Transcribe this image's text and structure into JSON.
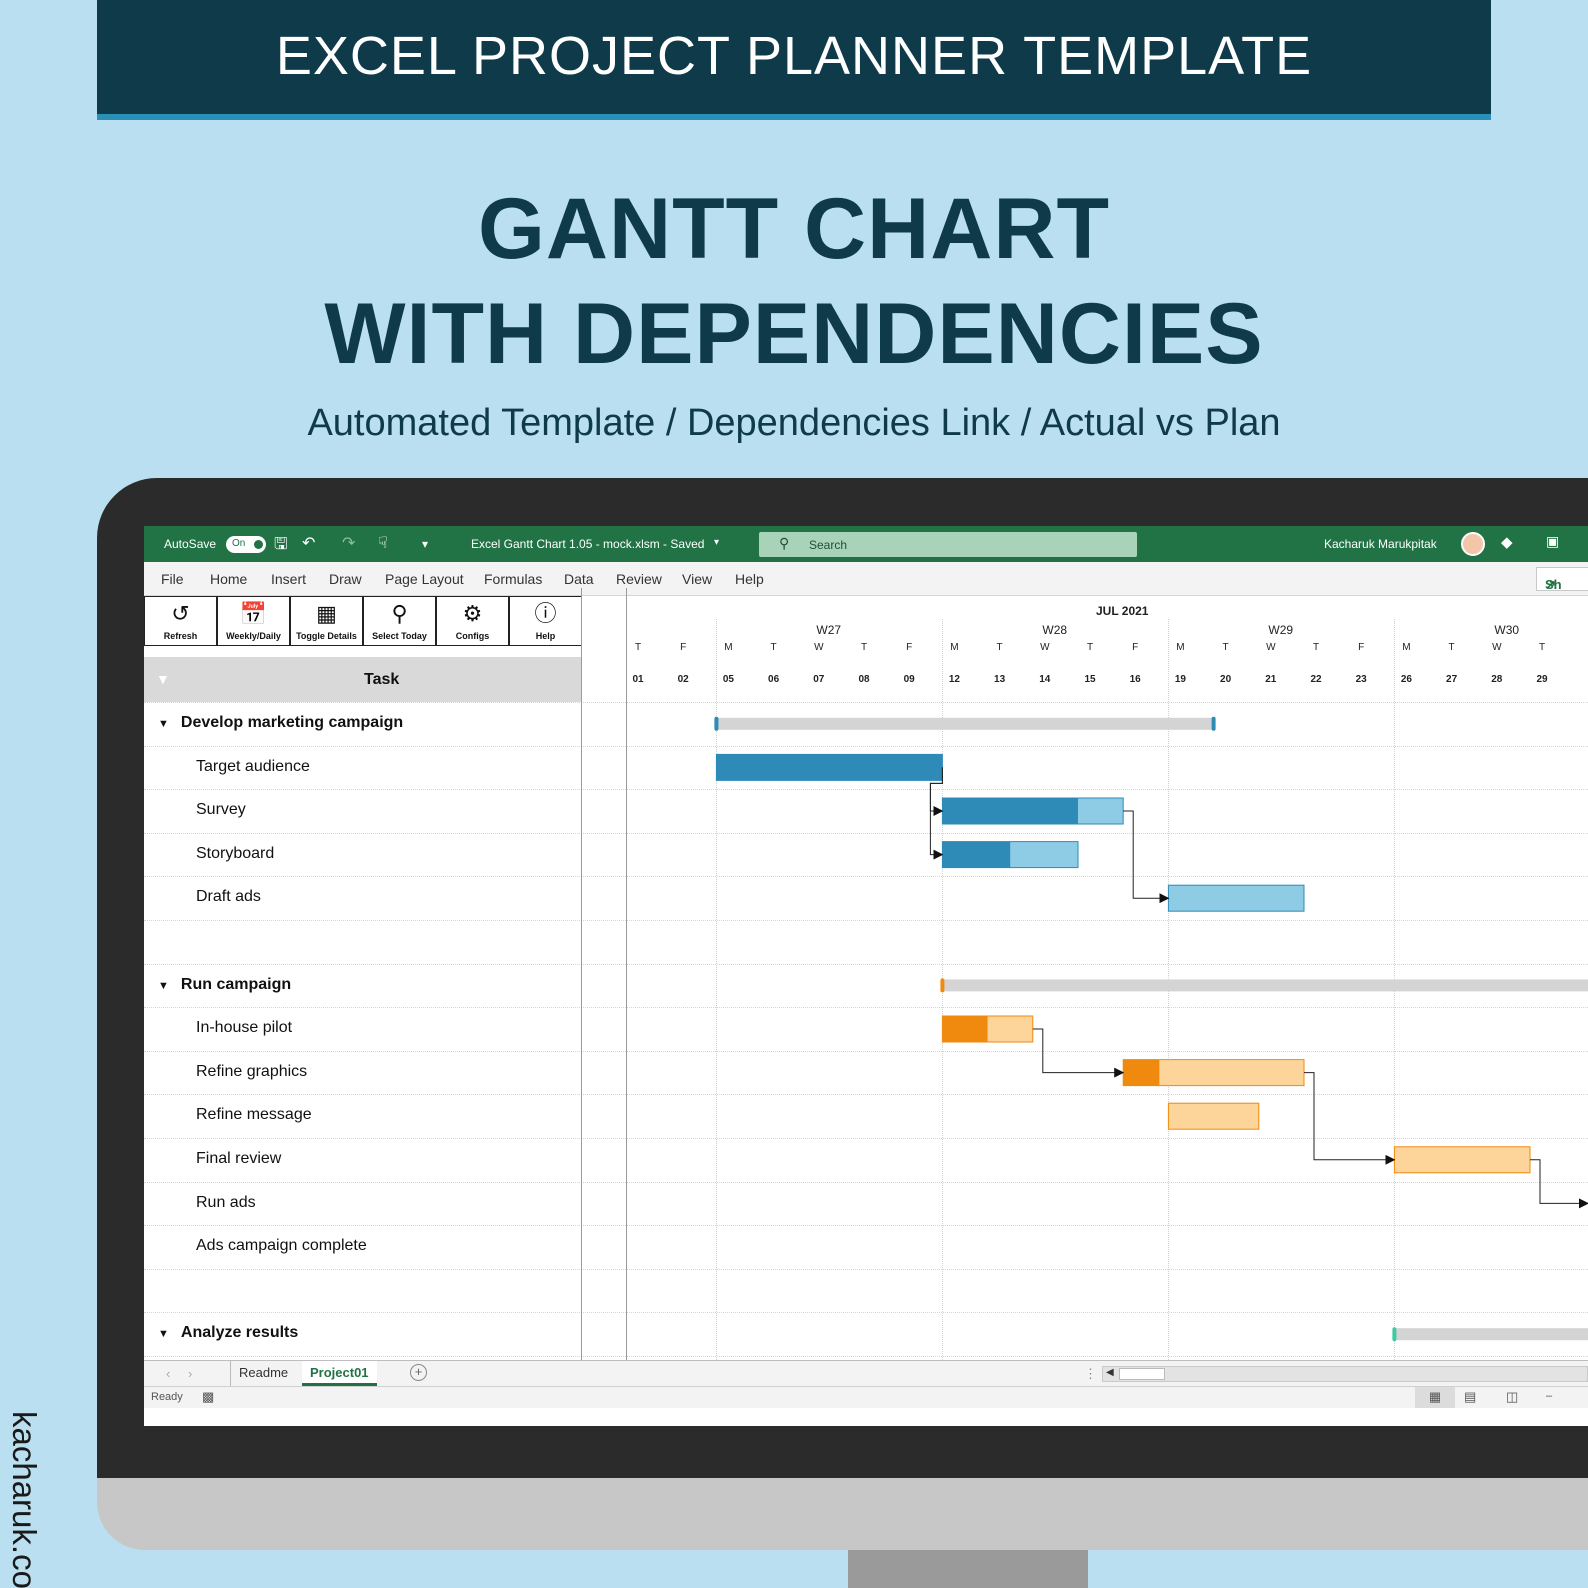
{
  "banner": {
    "title": "EXCEL PROJECT PLANNER TEMPLATE"
  },
  "hero": {
    "line1": "GANTT CHART",
    "line2": "WITH DEPENDENCIES",
    "subtitle": "Automated Template / Dependencies Link / Actual vs Plan"
  },
  "side_text": "kacharuk.com",
  "excel": {
    "autosave_label": "AutoSave",
    "autosave_state": "On",
    "file_title": "Excel Gantt Chart 1.05 - mock.xlsm  -  Saved",
    "search_placeholder": "Search",
    "user_name": "Kacharuk Marukpitak",
    "share_label": "Sh",
    "menu": [
      "File",
      "Home",
      "Insert",
      "Draw",
      "Page Layout",
      "Formulas",
      "Data",
      "Review",
      "View",
      "Help"
    ],
    "ribbon_buttons": [
      {
        "label": "Refresh",
        "icon": "refresh-icon"
      },
      {
        "label": "Weekly/Daily",
        "icon": "calendar-icon"
      },
      {
        "label": "Toggle Details",
        "icon": "table-icon"
      },
      {
        "label": "Select Today",
        "icon": "location-pin-icon"
      },
      {
        "label": "Configs",
        "icon": "gear-icon"
      },
      {
        "label": "Help",
        "icon": "question-icon"
      }
    ],
    "task_header": "Task",
    "rows": [
      {
        "label": "Develop marketing campaign",
        "group": true
      },
      {
        "label": "Target audience",
        "group": false
      },
      {
        "label": "Survey",
        "group": false
      },
      {
        "label": "Storyboard",
        "group": false
      },
      {
        "label": "Draft ads",
        "group": false
      },
      {
        "label": "",
        "group": false
      },
      {
        "label": "Run campaign",
        "group": true
      },
      {
        "label": "In-house pilot",
        "group": false
      },
      {
        "label": "Refine graphics",
        "group": false
      },
      {
        "label": "Refine message",
        "group": false
      },
      {
        "label": "Final review",
        "group": false
      },
      {
        "label": "Run ads",
        "group": false
      },
      {
        "label": "Ads campaign complete",
        "group": false
      },
      {
        "label": "",
        "group": false
      },
      {
        "label": "Analyze results",
        "group": true
      }
    ],
    "timeline": {
      "month": "JUL 2021",
      "weeks": [
        "W27",
        "W28",
        "W29",
        "W30"
      ],
      "days": [
        {
          "dow": "T",
          "date": "01"
        },
        {
          "dow": "F",
          "date": "02"
        },
        {
          "dow": "M",
          "date": "05"
        },
        {
          "dow": "T",
          "date": "06"
        },
        {
          "dow": "W",
          "date": "07"
        },
        {
          "dow": "T",
          "date": "08"
        },
        {
          "dow": "F",
          "date": "09"
        },
        {
          "dow": "M",
          "date": "12"
        },
        {
          "dow": "T",
          "date": "13"
        },
        {
          "dow": "W",
          "date": "14"
        },
        {
          "dow": "T",
          "date": "15"
        },
        {
          "dow": "F",
          "date": "16"
        },
        {
          "dow": "M",
          "date": "19"
        },
        {
          "dow": "T",
          "date": "20"
        },
        {
          "dow": "W",
          "date": "21"
        },
        {
          "dow": "T",
          "date": "22"
        },
        {
          "dow": "F",
          "date": "23"
        },
        {
          "dow": "M",
          "date": "26"
        },
        {
          "dow": "T",
          "date": "27"
        },
        {
          "dow": "W",
          "date": "28"
        },
        {
          "dow": "T",
          "date": "29"
        }
      ]
    },
    "gantt_bars": [
      {
        "row": 0,
        "start": "2021-07-05",
        "end": "2021-07-19",
        "kind": "summary",
        "color": "#2e8bb8"
      },
      {
        "row": 1,
        "start": "2021-07-05",
        "end": "2021-07-09",
        "progress": 1.0,
        "kind": "task",
        "done": "#2e8bb8",
        "plan": "#8ecbe4"
      },
      {
        "row": 2,
        "start": "2021-07-12",
        "end": "2021-07-15",
        "progress": 0.75,
        "kind": "task",
        "done": "#2e8bb8",
        "plan": "#8ecbe4"
      },
      {
        "row": 3,
        "start": "2021-07-12",
        "end": "2021-07-14",
        "progress": 0.5,
        "kind": "task",
        "done": "#2e8bb8",
        "plan": "#8ecbe4"
      },
      {
        "row": 4,
        "start": "2021-07-19",
        "end": "2021-07-21",
        "progress": 0,
        "kind": "task",
        "done": "#2e8bb8",
        "plan": "#8ecbe4"
      },
      {
        "row": 6,
        "start": "2021-07-12",
        "end": "2021-07-31",
        "kind": "summary",
        "color": "#f08a0e"
      },
      {
        "row": 7,
        "start": "2021-07-12",
        "end": "2021-07-13",
        "progress": 0.5,
        "kind": "task",
        "done": "#f08a0e",
        "plan": "#fdd49a"
      },
      {
        "row": 8,
        "start": "2021-07-16",
        "end": "2021-07-21",
        "progress": 0.2,
        "kind": "task",
        "done": "#f08a0e",
        "plan": "#fdd49a"
      },
      {
        "row": 9,
        "start": "2021-07-19",
        "end": "2021-07-20",
        "progress": 0,
        "kind": "task",
        "done": "#f08a0e",
        "plan": "#fdd49a"
      },
      {
        "row": 10,
        "start": "2021-07-26",
        "end": "2021-07-28",
        "progress": 0,
        "kind": "task",
        "done": "#f08a0e",
        "plan": "#fdd49a"
      },
      {
        "row": 14,
        "start": "2021-07-26",
        "end": "2021-07-31",
        "kind": "summary",
        "color": "#3ec9a0"
      }
    ],
    "dependencies": [
      {
        "from_row": 1,
        "to_row": 2
      },
      {
        "from_row": 1,
        "to_row": 3
      },
      {
        "from_row": 2,
        "to_row": 4
      },
      {
        "from_row": 7,
        "to_row": 8
      },
      {
        "from_row": 8,
        "to_row": 10
      },
      {
        "from_row": 10,
        "to_row": 11
      }
    ],
    "sheet_tabs": [
      "Readme",
      "Project01"
    ],
    "active_tab": "Project01",
    "status": "Ready"
  }
}
